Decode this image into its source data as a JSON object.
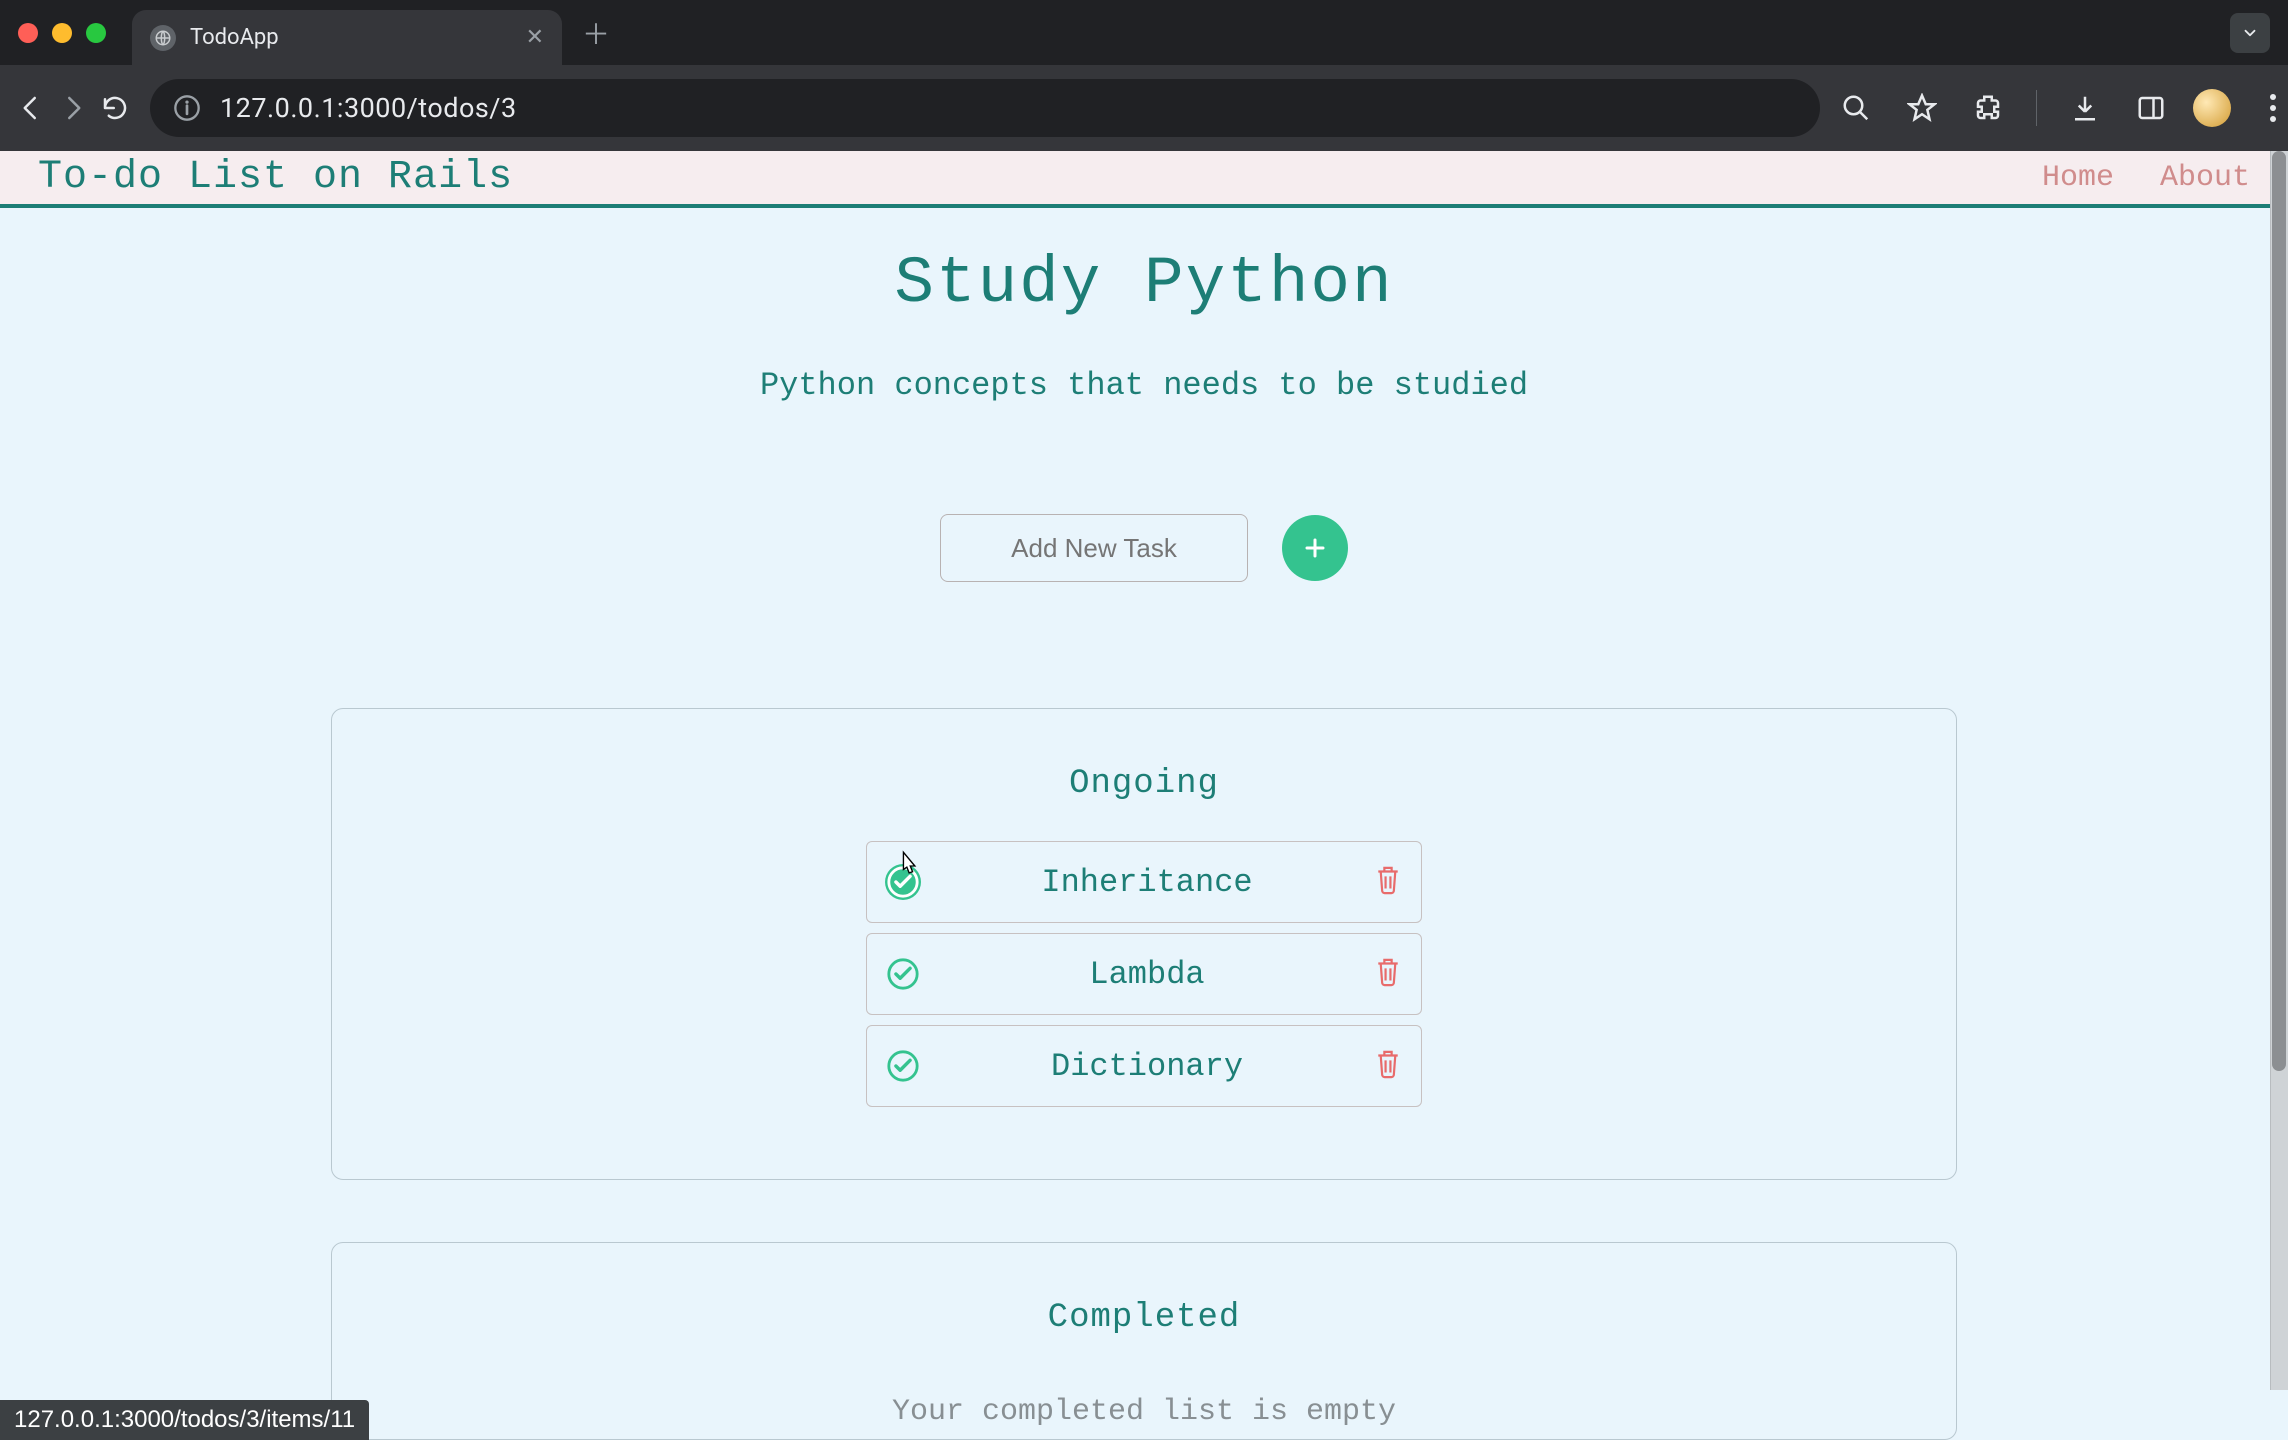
{
  "browser": {
    "tab_title": "TodoApp",
    "url": "127.0.0.1:3000/todos/3",
    "status_bar": "127.0.0.1:3000/todos/3/items/11"
  },
  "header": {
    "brand": "To-do List on Rails",
    "nav": {
      "home": "Home",
      "about": "About"
    }
  },
  "page": {
    "title": "Study Python",
    "subtitle": "Python concepts that needs to be studied",
    "add_placeholder": "Add New Task"
  },
  "sections": {
    "ongoing": {
      "heading": "Ongoing",
      "items": [
        {
          "label": "Inheritance"
        },
        {
          "label": "Lambda"
        },
        {
          "label": "Dictionary"
        }
      ]
    },
    "completed": {
      "heading": "Completed",
      "empty": "Your completed list is empty"
    }
  },
  "icons": {
    "plus": "plus-icon",
    "check": "check-circle-icon",
    "trash": "trash-icon"
  },
  "colors": {
    "accent": "#1d7e76",
    "success": "#34c38f",
    "danger": "#e86b6b",
    "page_bg": "#e9f5fc",
    "header_bg": "#f6edef"
  }
}
